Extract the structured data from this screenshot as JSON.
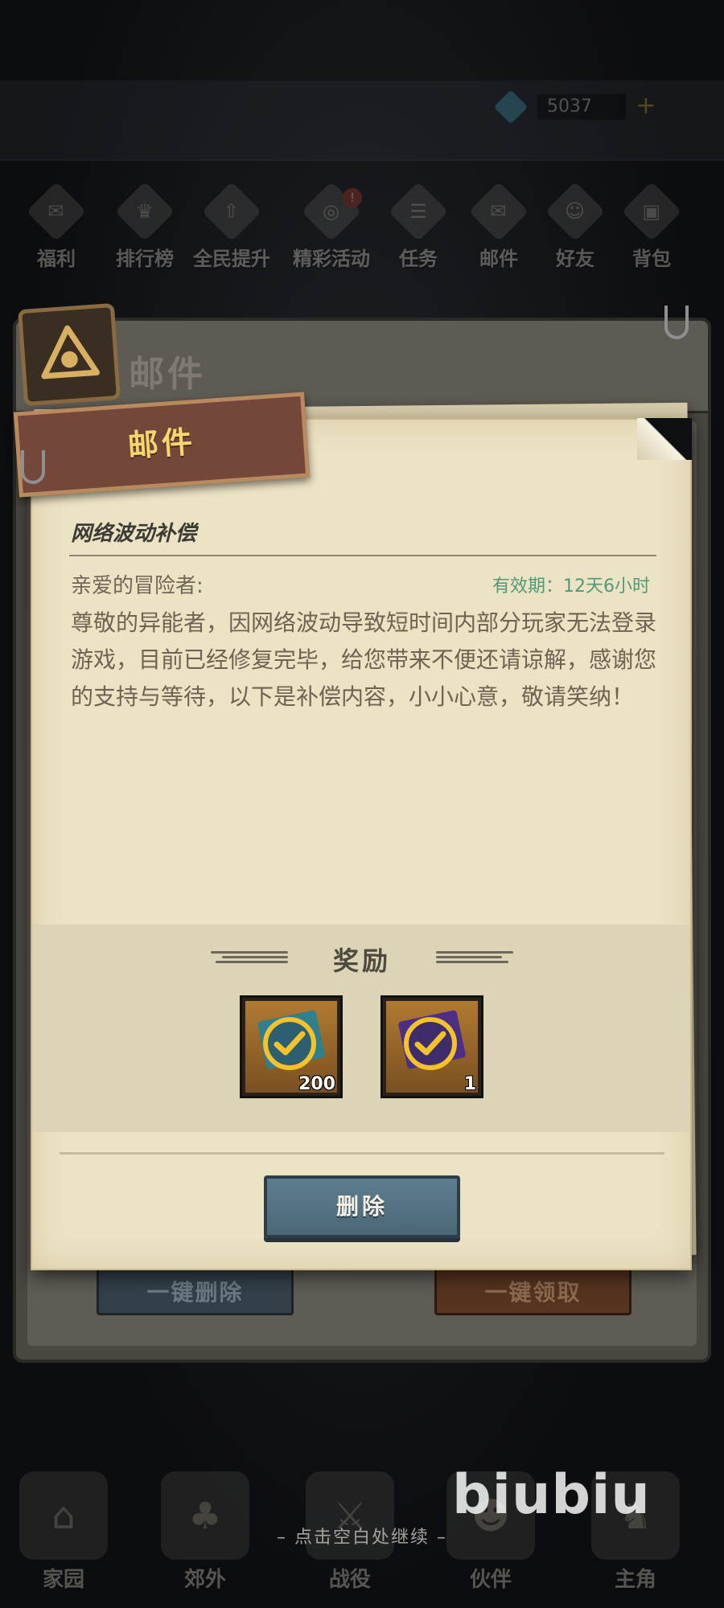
{
  "background_hud": {
    "currency_value": "5037",
    "top_nav": [
      {
        "label": "福利",
        "icon": "welfare-icon",
        "glyph": "✉"
      },
      {
        "label": "排行榜",
        "icon": "ranking-icon",
        "glyph": "♛"
      },
      {
        "label": "全民提升",
        "icon": "upgrade-icon",
        "glyph": "⇧"
      },
      {
        "label": "精彩活动",
        "icon": "event-icon",
        "glyph": "◎",
        "badge": "!"
      },
      {
        "label": "任务",
        "icon": "quest-icon",
        "glyph": "☰"
      },
      {
        "label": "邮件",
        "icon": "mail-icon",
        "glyph": "✉"
      },
      {
        "label": "好友",
        "icon": "friends-icon",
        "glyph": "☺"
      },
      {
        "label": "背包",
        "icon": "bag-icon",
        "glyph": "▣"
      }
    ],
    "bottom_nav": [
      {
        "label": "家园",
        "icon": "home-icon",
        "glyph": "⌂"
      },
      {
        "label": "郊外",
        "icon": "outskirts-icon",
        "glyph": "♣"
      },
      {
        "label": "战役",
        "icon": "battle-icon",
        "glyph": "⚔"
      },
      {
        "label": "伙伴",
        "icon": "partner-icon",
        "glyph": "☻"
      },
      {
        "label": "主角",
        "icon": "hero-icon",
        "glyph": "♞"
      }
    ]
  },
  "mail_window": {
    "title": "邮件",
    "delete_all_label": "一键删除",
    "claim_all_label": "一键领取"
  },
  "letter": {
    "banner": "邮件",
    "subject": "网络波动补偿",
    "greeting": "亲爱的冒险者:",
    "validity": "有效期：12天6小时",
    "body": "尊敬的异能者，因网络波动导致短时间内部分玩家无法登录游戏，目前已经修复完毕，给您带来不便还请谅解，感谢您的支持与等待，以下是补偿内容，小小心意，敬请笑纳！",
    "rewards_title": "奖励",
    "rewards": [
      {
        "icon": "teal-ticket-icon",
        "color": "#2f7f8e",
        "quantity": "200"
      },
      {
        "icon": "purple-ticket-icon",
        "color": "#4b2f86",
        "quantity": "1"
      }
    ],
    "delete_button": "删除"
  },
  "continue_hint": "–  点击空白处继续  –",
  "watermark": "biubiu"
}
